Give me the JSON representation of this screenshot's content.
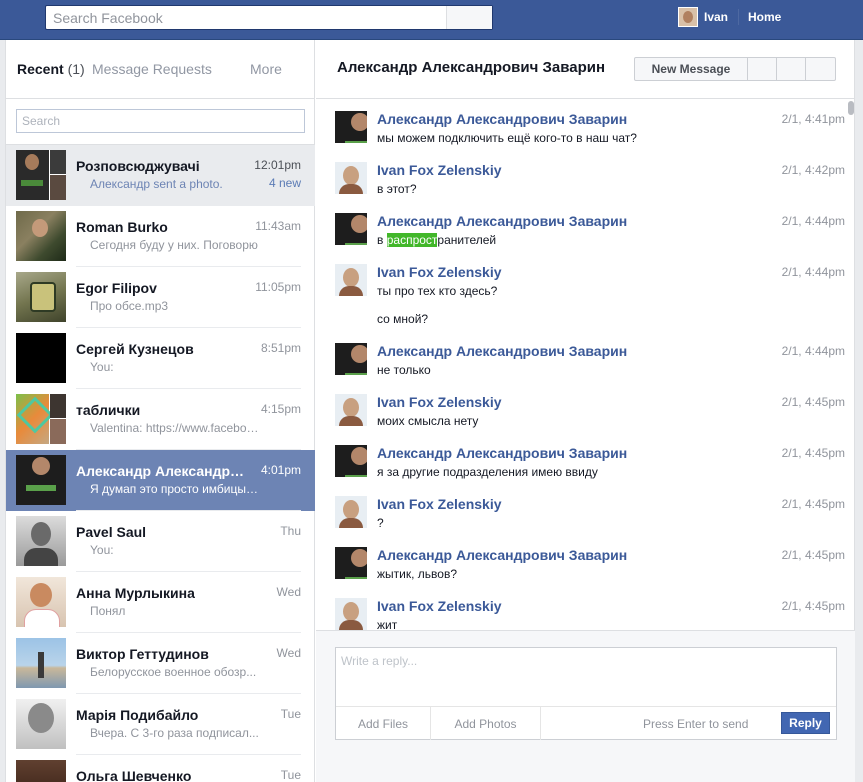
{
  "topbar": {
    "search_placeholder": "Search Facebook",
    "user_name": "Ivan",
    "home_label": "Home"
  },
  "left": {
    "tab_recent": "Recent",
    "tab_recent_count": "(1)",
    "tab_requests": "Message Requests",
    "tab_more": "More",
    "search_placeholder": "Search",
    "threads": [
      {
        "name": "Розповсюджувачі",
        "time": "12:01pm",
        "snippet": "Александр sent a photo.",
        "badge": "4 new"
      },
      {
        "name": "Roman Burko",
        "time": "11:43am",
        "snippet": "Сегодня буду у них. Поговорю"
      },
      {
        "name": "Egor Filipov",
        "time": "11:05pm",
        "snippet": "Про обсе.mp3"
      },
      {
        "name": "Сергей Кузнецов",
        "time": "8:51pm",
        "snippet": "You:"
      },
      {
        "name": "таблички",
        "time": "4:15pm",
        "snippet": "Valentina: https://www.faceboo..."
      },
      {
        "name": "Александр Александров...",
        "time": "4:01pm",
        "snippet": "Я думап это просто имбицыл..."
      },
      {
        "name": "Pavel Saul",
        "time": "Thu",
        "snippet": "You:"
      },
      {
        "name": "Анна Мурлыкина",
        "time": "Wed",
        "snippet": "Понял"
      },
      {
        "name": "Виктор Геттудинов",
        "time": "Wed",
        "snippet": "Белорусское военное обозр..."
      },
      {
        "name": "Марія Подибайло",
        "time": "Tue",
        "snippet": "Вчера. С 3-го раза подписал..."
      },
      {
        "name": "Ольга Шевченко",
        "time": "Tue",
        "snippet": ""
      }
    ]
  },
  "conversation": {
    "title": "Александр Александрович Заварин",
    "new_message_label": "New Message",
    "messages": [
      {
        "author": "Александр Александрович Заварин",
        "time": "2/1, 4:41pm",
        "lines": [
          "мы можем подключить ещё кого-то в наш чат?"
        ]
      },
      {
        "author": "Ivan Fox Zelenskiy",
        "time": "2/1, 4:42pm",
        "lines": [
          "в этот?"
        ]
      },
      {
        "author": "Александр Александрович Заварин",
        "time": "2/1, 4:44pm",
        "text_prefix": "в ",
        "text_highlight": "распрост",
        "text_suffix": "ранителей"
      },
      {
        "author": "Ivan Fox Zelenskiy",
        "time": "2/1, 4:44pm",
        "lines": [
          "ты про тех кто здесь?",
          "со мной?"
        ]
      },
      {
        "author": "Александр Александрович Заварин",
        "time": "2/1, 4:44pm",
        "lines": [
          "не только"
        ]
      },
      {
        "author": "Ivan Fox Zelenskiy",
        "time": "2/1, 4:45pm",
        "lines": [
          "моих смысла нету"
        ]
      },
      {
        "author": "Александр Александрович Заварин",
        "time": "2/1, 4:45pm",
        "lines": [
          "я за другие подразделения имею ввиду"
        ]
      },
      {
        "author": "Ivan Fox Zelenskiy",
        "time": "2/1, 4:45pm",
        "lines": [
          "?"
        ]
      },
      {
        "author": "Александр Александрович Заварин",
        "time": "2/1, 4:45pm",
        "lines": [
          "жытик, львов?"
        ]
      },
      {
        "author": "Ivan Fox Zelenskiy",
        "time": "2/1, 4:45pm",
        "lines": [
          "жит"
        ]
      }
    ]
  },
  "composer": {
    "placeholder": "Write a reply...",
    "add_files": "Add Files",
    "add_photos": "Add Photos",
    "enter_hint": "Press Enter to send",
    "reply_label": "Reply"
  }
}
